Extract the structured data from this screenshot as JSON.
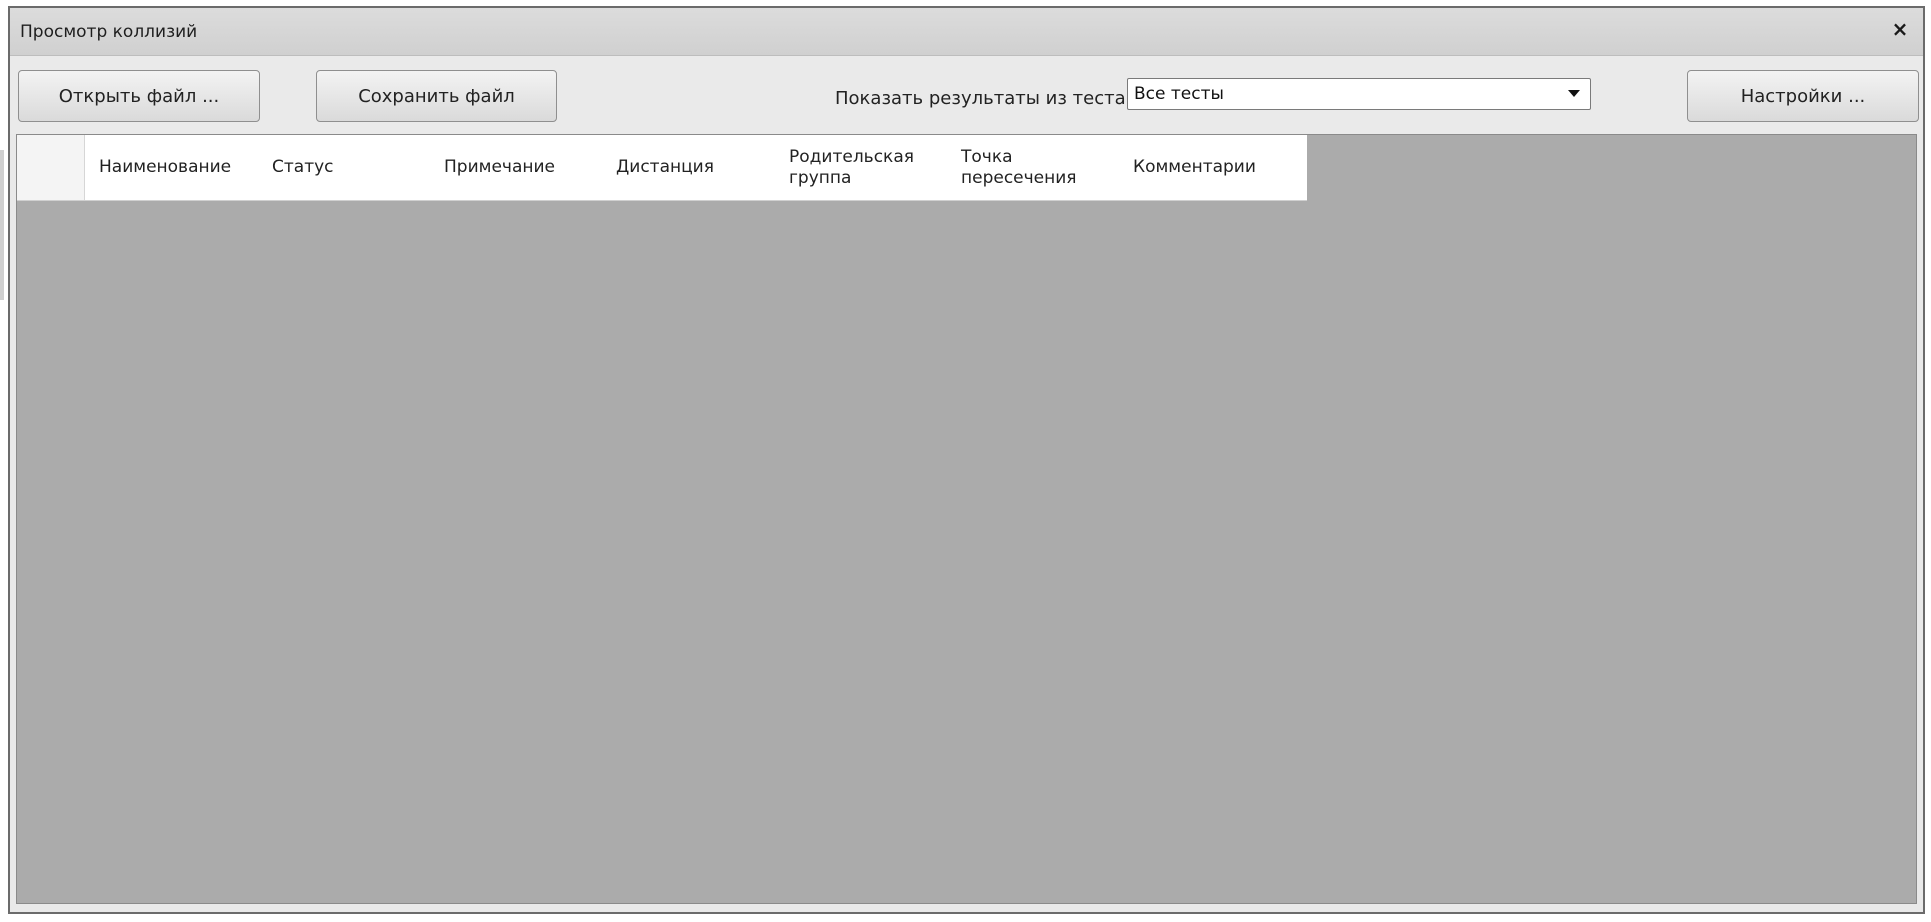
{
  "window": {
    "title": "Просмотр коллизий",
    "close_label": "×"
  },
  "toolbar": {
    "open_label": "Открыть файл ...",
    "save_label": "Сохранить файл",
    "filter_label": "Показать результаты из теста:",
    "filter_value": "Все тесты",
    "settings_label": "Настройки ..."
  },
  "grid": {
    "columns": [
      "Наименование",
      "Статус",
      "Примечание",
      "Дистанция",
      "Родительская группа",
      "Точка пересечения",
      "Комментарии"
    ],
    "rows": []
  },
  "colors": {
    "grid_background": "#ababab",
    "window_background": "#e9e9e9"
  }
}
